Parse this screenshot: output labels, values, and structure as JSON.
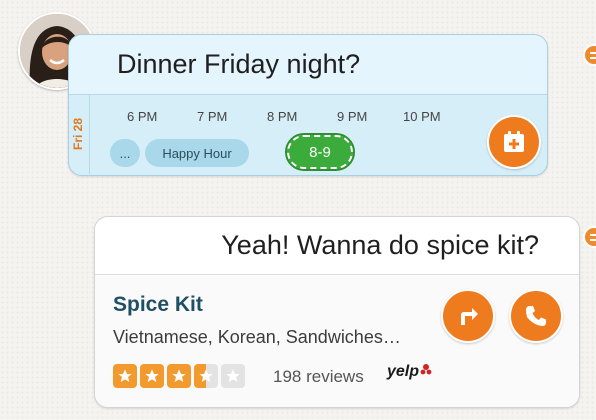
{
  "message1": {
    "text": "Dinner Friday night?",
    "avatar": "avatar",
    "calendar": {
      "date_label": "Fri 28",
      "hours": [
        "6 PM",
        "7 PM",
        "8 PM",
        "9 PM",
        "10 PM"
      ],
      "more_label": "...",
      "event_label": "Happy Hour",
      "proposed_slot": "8-9",
      "action_icon": "calendar-add-icon"
    }
  },
  "message2": {
    "text": "Yeah! Wanna do spice kit?",
    "place": {
      "name": "Spice Kit",
      "categories": "Vietnamese, Korean, Sandwiches…",
      "rating": 3.5,
      "rating_max": 5,
      "reviews": "198 reviews",
      "source": "yelp",
      "directions_icon": "directions-icon",
      "call_icon": "phone-icon"
    }
  },
  "colors": {
    "accent": "#ee7c1e",
    "bubble_blue": "#d6eef8",
    "slot_green": "#3bab3b",
    "event_blue": "#a8d8ea",
    "place_name": "#1e4f63"
  }
}
